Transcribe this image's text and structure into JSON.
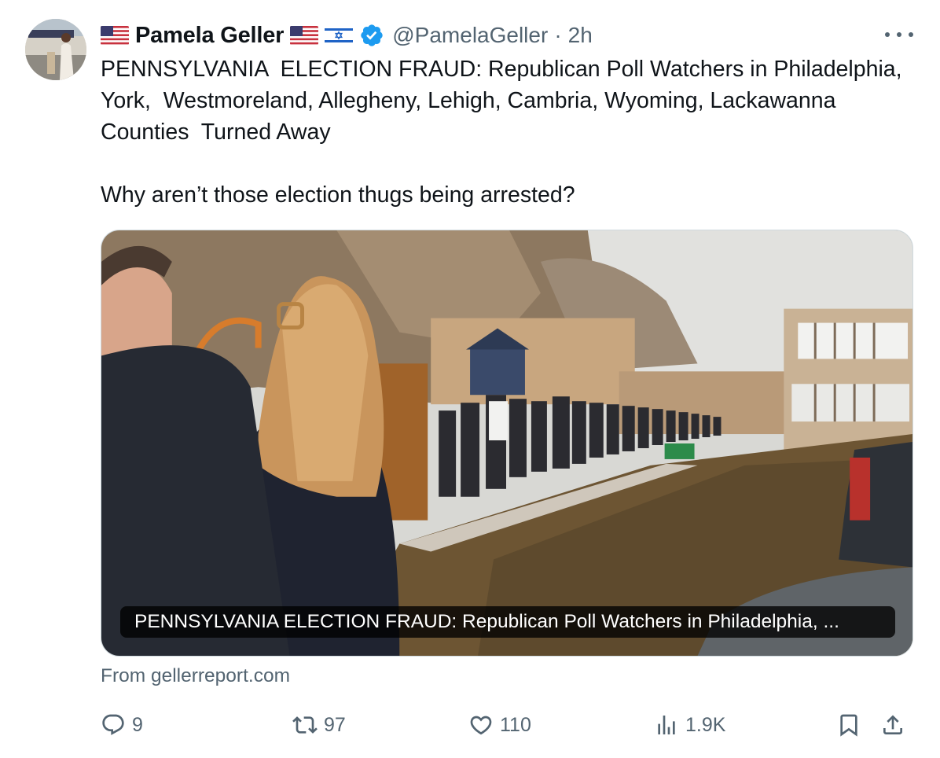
{
  "author": {
    "name": "Pamela Geller",
    "handle": "@PamelaGeller",
    "time": "2h",
    "separator": "·",
    "flags": [
      "us-flag",
      "us-flag",
      "israel-flag"
    ],
    "verified_color": "#1d9bf0"
  },
  "tweet": {
    "text": "PENNSYLVANIA  ELECTION FRAUD: Republican Poll Watchers in Philadelphia, York,  Westmoreland, Allegheny, Lehigh, Cambria, Wyoming, Lackawanna Counties  Turned Away\n\nWhy aren’t those election thugs being arrested?"
  },
  "card": {
    "caption": "PENNSYLVANIA ELECTION FRAUD: Republican Poll Watchers in Philadelphia, ...",
    "source": "From gellerreport.com"
  },
  "actions": {
    "replies": "9",
    "reposts": "97",
    "likes": "110",
    "views": "1.9K"
  },
  "icons": {
    "reply": "reply-icon",
    "repost": "repost-icon",
    "like": "heart-icon",
    "views": "views-icon",
    "bookmark": "bookmark-icon",
    "share": "share-icon",
    "more": "more-icon"
  },
  "colors": {
    "text": "#0f1419",
    "secondary": "#536471",
    "border": "#cfd9de"
  }
}
